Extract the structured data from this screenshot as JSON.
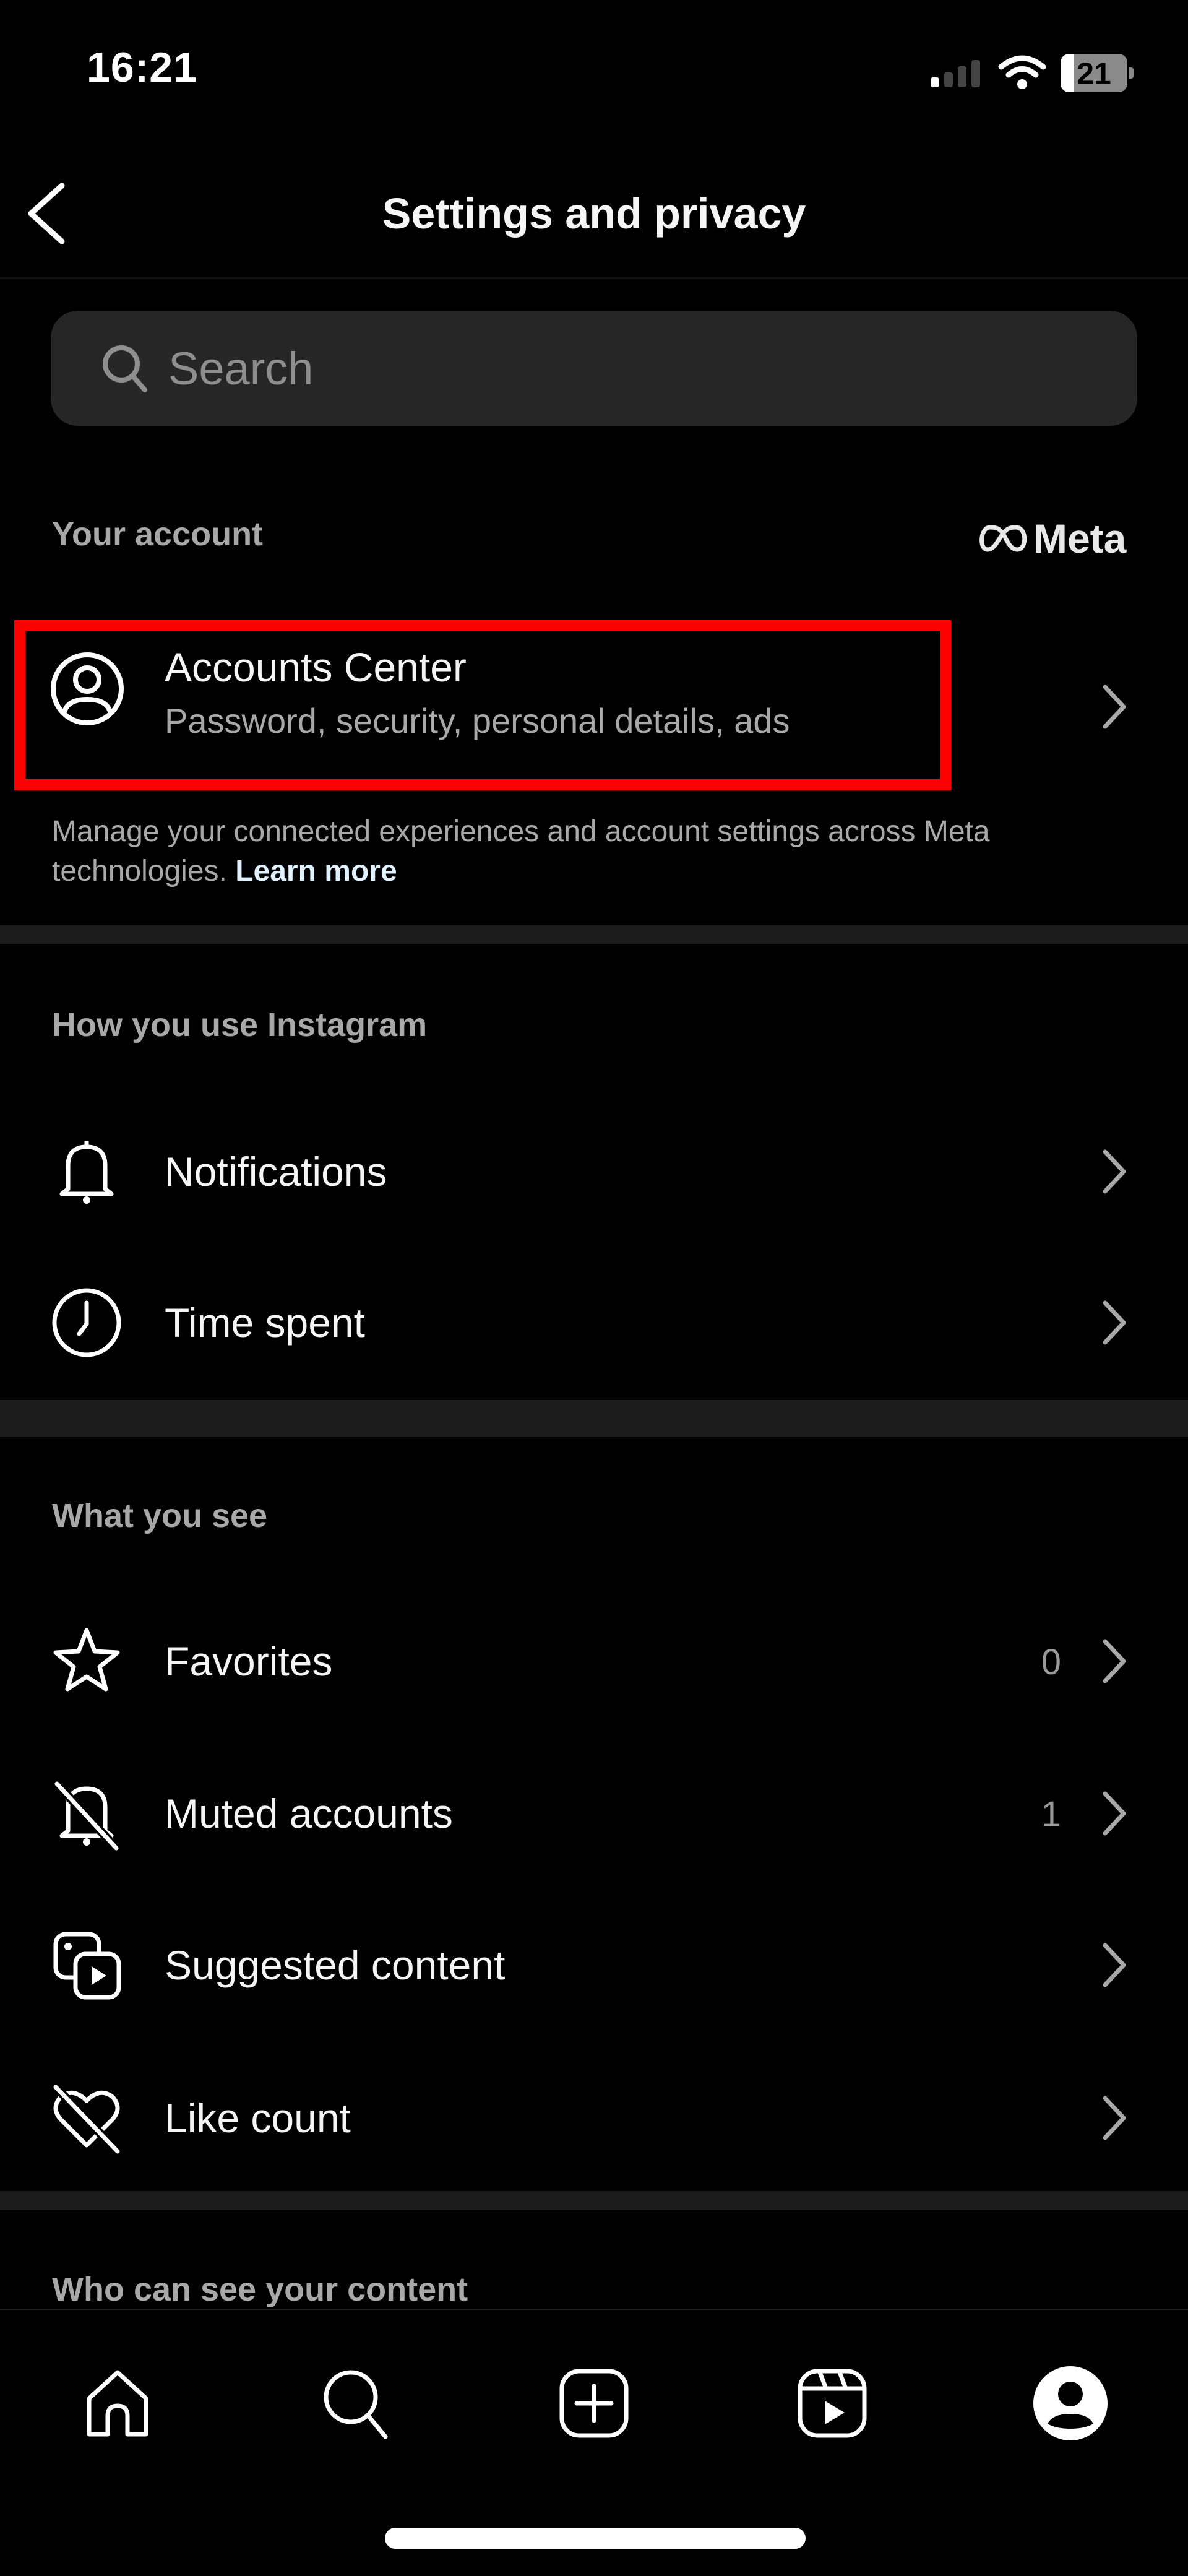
{
  "status_bar": {
    "time": "16:21",
    "battery_level": "21",
    "signal_bars_active": 1,
    "signal_bars_total": 4,
    "icons": [
      "signal-icon",
      "wifi-icon",
      "battery-icon"
    ]
  },
  "header": {
    "title": "Settings and privacy",
    "back_icon": "chevron-left-icon"
  },
  "search": {
    "placeholder": "Search",
    "value": "",
    "icon": "search-icon"
  },
  "sections": {
    "your_account": {
      "label": "Your account",
      "brand": "Meta",
      "brand_icon": "meta-infinity-icon",
      "accounts_center": {
        "title": "Accounts Center",
        "subtitle": "Password, security, personal details, ads",
        "icon": "account-circle-icon",
        "highlighted": true,
        "highlight_color": "#ff0000"
      },
      "helper_text": "Manage your connected experiences and account settings across Meta technologies.",
      "learn_more": "Learn more"
    },
    "how_you_use": {
      "label": "How you use Instagram",
      "items": [
        {
          "label": "Notifications",
          "icon": "bell-icon",
          "count": ""
        },
        {
          "label": "Time spent",
          "icon": "clock-icon",
          "count": ""
        }
      ]
    },
    "what_you_see": {
      "label": "What you see",
      "items": [
        {
          "label": "Favorites",
          "icon": "star-icon",
          "count": "0"
        },
        {
          "label": "Muted accounts",
          "icon": "bell-off-icon",
          "count": "1"
        },
        {
          "label": "Suggested content",
          "icon": "suggested-content-icon",
          "count": ""
        },
        {
          "label": "Like count",
          "icon": "heart-off-icon",
          "count": ""
        }
      ]
    },
    "who_can_see": {
      "label": "Who can see your content"
    }
  },
  "bottom_nav": {
    "items": [
      {
        "name": "home",
        "icon": "home-icon"
      },
      {
        "name": "search",
        "icon": "search-icon"
      },
      {
        "name": "create",
        "icon": "plus-square-icon"
      },
      {
        "name": "reels",
        "icon": "reels-icon"
      },
      {
        "name": "profile",
        "icon": "profile-icon",
        "active": true
      }
    ]
  },
  "colors": {
    "background": "#000000",
    "text_primary": "#f5f5f5",
    "text_secondary": "#a8a8a8",
    "search_bg": "#262626",
    "section_divider": "#1c1c1c",
    "link": "#e0f1ff",
    "highlight": "#ff0000"
  }
}
